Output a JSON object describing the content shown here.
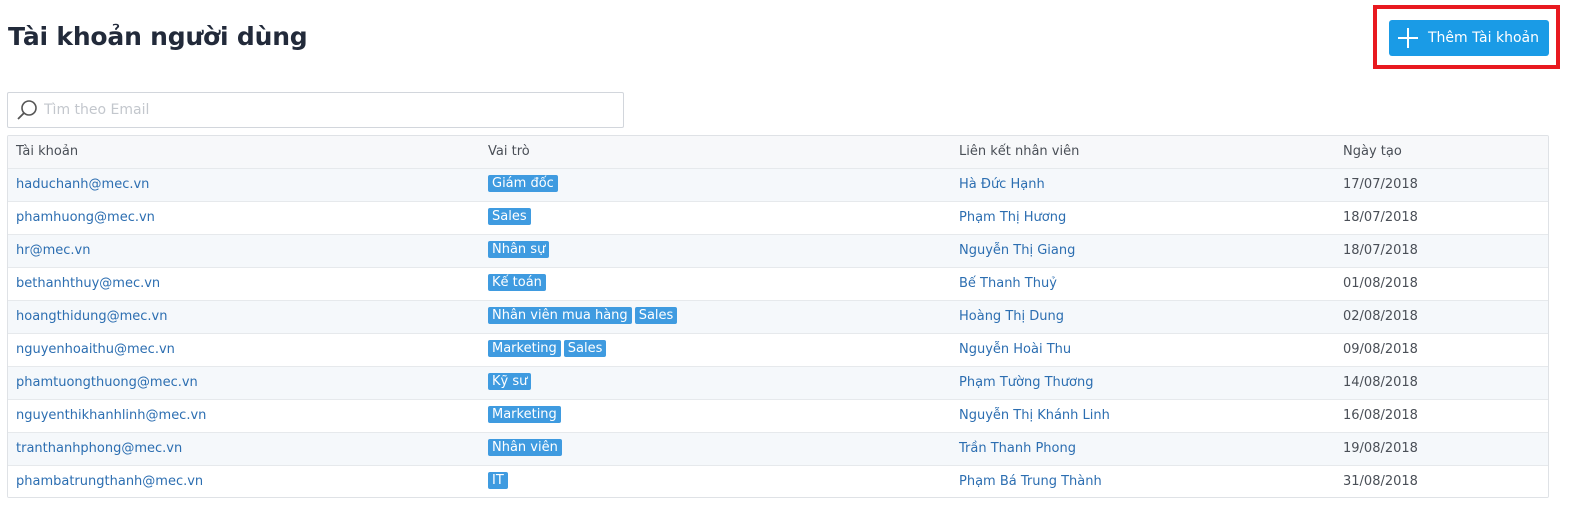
{
  "header": {
    "title": "Tài khoản người dùng",
    "add_button_label": "Thêm Tài khoản"
  },
  "search": {
    "placeholder": "Tìm theo Email",
    "value": ""
  },
  "table": {
    "columns": [
      "Tài khoản",
      "Vai trò",
      "Liên kết nhân viên",
      "Ngày tạo"
    ],
    "rows": [
      {
        "account": "haduchanh@mec.vn",
        "roles": [
          "Giám đốc"
        ],
        "employee": "Hà Đức Hạnh",
        "created": "17/07/2018"
      },
      {
        "account": "phamhuong@mec.vn",
        "roles": [
          "Sales"
        ],
        "employee": "Phạm Thị Hương",
        "created": "18/07/2018"
      },
      {
        "account": "hr@mec.vn",
        "roles": [
          "Nhân sự"
        ],
        "employee": "Nguyễn Thị Giang",
        "created": "18/07/2018"
      },
      {
        "account": "bethanhthuy@mec.vn",
        "roles": [
          "Kế toán"
        ],
        "employee": "Bế Thanh Thuỷ",
        "created": "01/08/2018"
      },
      {
        "account": "hoangthidung@mec.vn",
        "roles": [
          "Nhân viên mua hàng",
          "Sales"
        ],
        "employee": "Hoàng Thị Dung",
        "created": "02/08/2018"
      },
      {
        "account": "nguyenhoaithu@mec.vn",
        "roles": [
          "Marketing",
          "Sales"
        ],
        "employee": "Nguyễn Hoài Thu",
        "created": "09/08/2018"
      },
      {
        "account": "phamtuongthuong@mec.vn",
        "roles": [
          "Kỹ sư"
        ],
        "employee": "Phạm Tường Thương",
        "created": "14/08/2018"
      },
      {
        "account": "nguyenthikhanhlinh@mec.vn",
        "roles": [
          "Marketing"
        ],
        "employee": "Nguyễn Thị Khánh Linh",
        "created": "16/08/2018"
      },
      {
        "account": "tranthanhphong@mec.vn",
        "roles": [
          "Nhân viên"
        ],
        "employee": "Trần Thanh Phong",
        "created": "19/08/2018"
      },
      {
        "account": "phambatrungthanh@mec.vn",
        "roles": [
          "IT"
        ],
        "employee": "Phạm Bá Trung Thành",
        "created": "31/08/2018"
      }
    ]
  },
  "colors": {
    "accent": "#1a9be6",
    "tag": "#3f9be0",
    "link": "#2c6eb1",
    "highlight_border": "#e8191f"
  },
  "icons": {
    "add": "plus-icon",
    "search": "search-icon"
  }
}
